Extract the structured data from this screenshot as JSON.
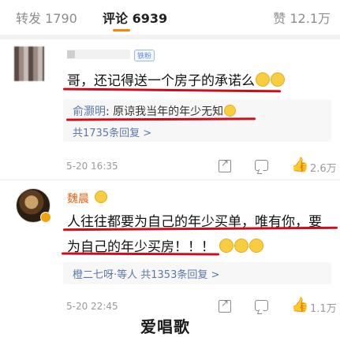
{
  "tabs": {
    "repost": "转发 1790",
    "comment": "评论 6939",
    "like": "赞 12.1万"
  },
  "comment1": {
    "badge": "铁粉",
    "text": "哥，还记得送一个房子的承诺么",
    "reply": {
      "name": "俞灏明",
      "text": ": 原谅我当年的年少无知",
      "more": "共1735条回复 >"
    },
    "time": "5-20 16:35",
    "likes": "2.6万"
  },
  "comment2": {
    "name": "魏晨",
    "text_line1": "人往往都要为自己的年少买单，唯有你，要",
    "text_line2": "为自己的年少买房！！！",
    "reply_summary": "橙二七呀·等人 共1353条回复 >",
    "time": "5-20 22:45",
    "likes": "1.1万"
  },
  "watermark": "爱唱歌",
  "colors": {
    "accent": "#ff8200",
    "underline": "#c8101c",
    "link": "#5b78a8"
  }
}
